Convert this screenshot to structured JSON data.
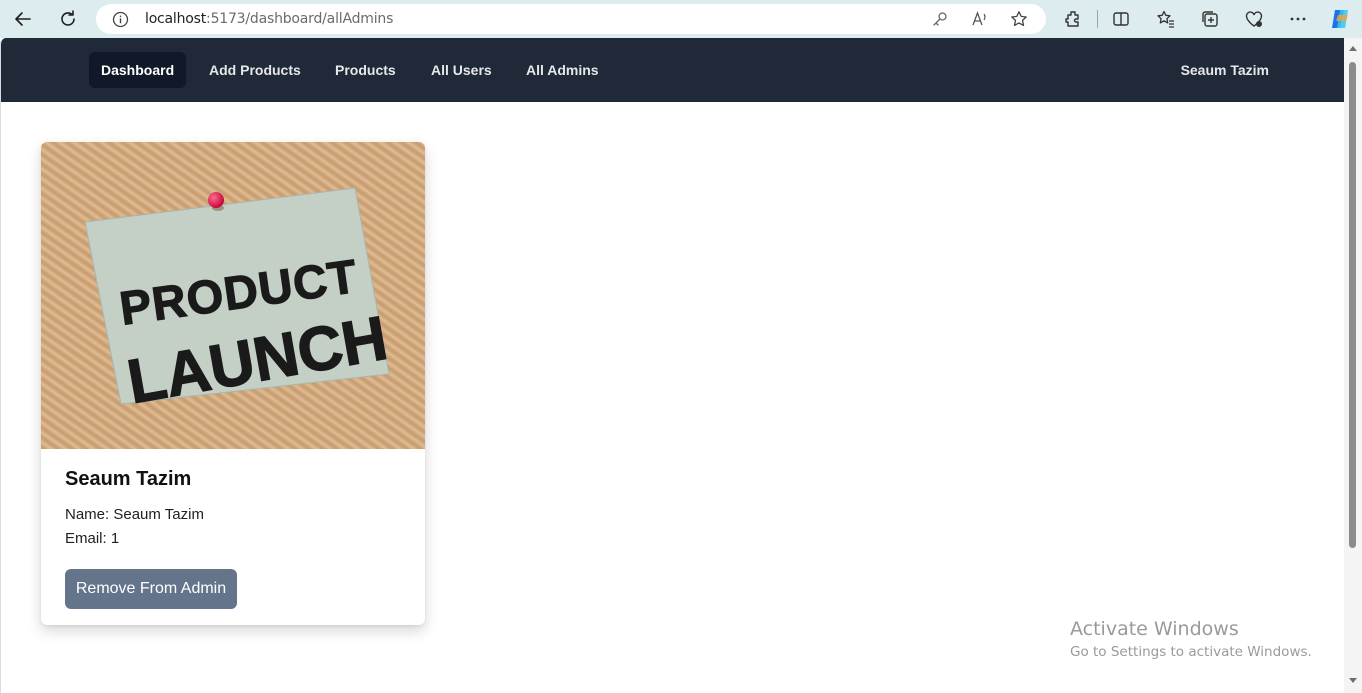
{
  "browser": {
    "url_host": "localhost",
    "url_path": ":5173/dashboard/allAdmins"
  },
  "navbar": {
    "links": [
      {
        "label": "Dashboard",
        "active": true
      },
      {
        "label": "Add Products",
        "active": false
      },
      {
        "label": "Products",
        "active": false
      },
      {
        "label": "All Users",
        "active": false
      },
      {
        "label": "All Admins",
        "active": false
      }
    ],
    "user_name": "Seaum Tazim"
  },
  "admins": [
    {
      "card_title": "Seaum Tazim",
      "name_line": "Name: Seaum Tazim",
      "email_line": "Email: 1",
      "image_text": [
        "PRODUCT",
        "LAUNCH"
      ],
      "remove_label": "Remove From Admin"
    }
  ],
  "watermark": {
    "title": "Activate Windows",
    "subtitle": "Go to Settings to activate Windows."
  },
  "colors": {
    "navbar_bg": "#1f2937",
    "nav_active_bg": "#111827",
    "button_bg": "#64748b",
    "browser_chrome": "#ddecef"
  },
  "icons": [
    "back-arrow-icon",
    "refresh-icon",
    "info-icon",
    "key-icon",
    "read-aloud-icon",
    "favorite-star-icon",
    "extensions-icon",
    "split-screen-icon",
    "favorites-icon",
    "collections-icon",
    "browser-essentials-icon",
    "more-icon",
    "copilot-icon"
  ]
}
